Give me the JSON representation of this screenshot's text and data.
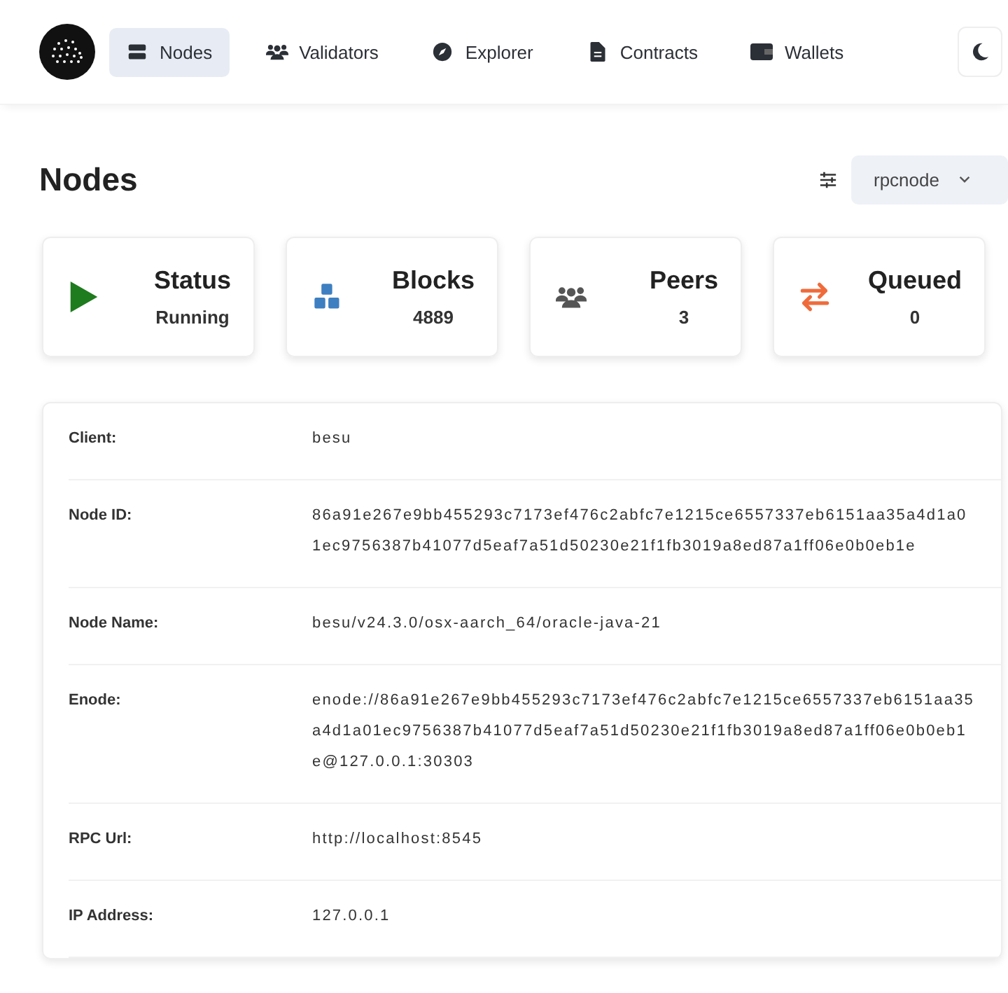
{
  "nav": {
    "items": [
      {
        "label": "Nodes",
        "kind": "nodes",
        "selected": true
      },
      {
        "label": "Validators",
        "kind": "people",
        "selected": false
      },
      {
        "label": "Explorer",
        "kind": "compass",
        "selected": false
      },
      {
        "label": "Contracts",
        "kind": "file",
        "selected": false
      },
      {
        "label": "Wallets",
        "kind": "wallet",
        "selected": false
      }
    ]
  },
  "page": {
    "title": "Nodes",
    "node_select": {
      "value": "rpcnode"
    }
  },
  "stats": [
    {
      "title": "Status",
      "value": "Running",
      "kind": "play"
    },
    {
      "title": "Blocks",
      "value": "4889",
      "kind": "cubes"
    },
    {
      "title": "Peers",
      "value": "3",
      "kind": "people"
    },
    {
      "title": "Queued",
      "value": "0",
      "kind": "swap"
    }
  ],
  "details": [
    {
      "label": "Client:",
      "value": "besu"
    },
    {
      "label": "Node ID:",
      "value": "86a91e267e9bb455293c7173ef476c2abfc7e1215ce6557337eb6151aa35a4d1a01ec9756387b41077d5eaf7a51d50230e21f1fb3019a8ed87a1ff06e0b0eb1e"
    },
    {
      "label": "Node Name:",
      "value": "besu/v24.3.0/osx-aarch_64/oracle-java-21"
    },
    {
      "label": "Enode:",
      "value": "enode://86a91e267e9bb455293c7173ef476c2abfc7e1215ce6557337eb6151aa35a4d1a01ec9756387b41077d5eaf7a51d50230e21f1fb3019a8ed87a1ff06e0b0eb1e@127.0.0.1:30303"
    },
    {
      "label": "RPC Url:",
      "value": "http://localhost:8545"
    },
    {
      "label": "IP Address:",
      "value": "127.0.0.1"
    }
  ]
}
